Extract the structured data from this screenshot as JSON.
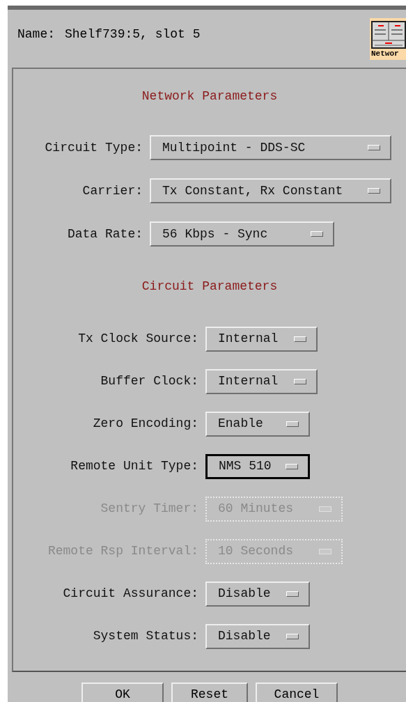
{
  "name_label": "Name:",
  "name_value": "Shelf739:5, slot 5",
  "icon_label": "Networ",
  "sections": [
    {
      "title": "Network Parameters",
      "fields": [
        {
          "label": "Circuit Type:",
          "value": "Multipoint - DDS-SC",
          "disabled": false,
          "focused": false
        },
        {
          "label": "Carrier:",
          "value": "Tx Constant, Rx Constant",
          "disabled": false,
          "focused": false
        },
        {
          "label": "Data Rate:",
          "value": "56 Kbps - Sync",
          "disabled": false,
          "focused": false
        }
      ]
    },
    {
      "title": "Circuit Parameters",
      "fields": [
        {
          "label": "Tx Clock Source:",
          "value": "Internal",
          "disabled": false,
          "focused": false
        },
        {
          "label": "Buffer Clock:",
          "value": "Internal",
          "disabled": false,
          "focused": false
        },
        {
          "label": "Zero Encoding:",
          "value": "Enable",
          "disabled": false,
          "focused": false
        },
        {
          "label": "Remote Unit Type:",
          "value": "NMS 510",
          "disabled": false,
          "focused": true
        },
        {
          "label": "Sentry Timer:",
          "value": "60 Minutes",
          "disabled": true,
          "focused": false
        },
        {
          "label": "Remote Rsp Interval:",
          "value": "10 Seconds",
          "disabled": true,
          "focused": false
        },
        {
          "label": "Circuit Assurance:",
          "value": "Disable",
          "disabled": false,
          "focused": false
        },
        {
          "label": "System Status:",
          "value": "Disable",
          "disabled": false,
          "focused": false
        }
      ]
    }
  ],
  "buttons": [
    "OK",
    "Reset",
    "Cancel"
  ]
}
